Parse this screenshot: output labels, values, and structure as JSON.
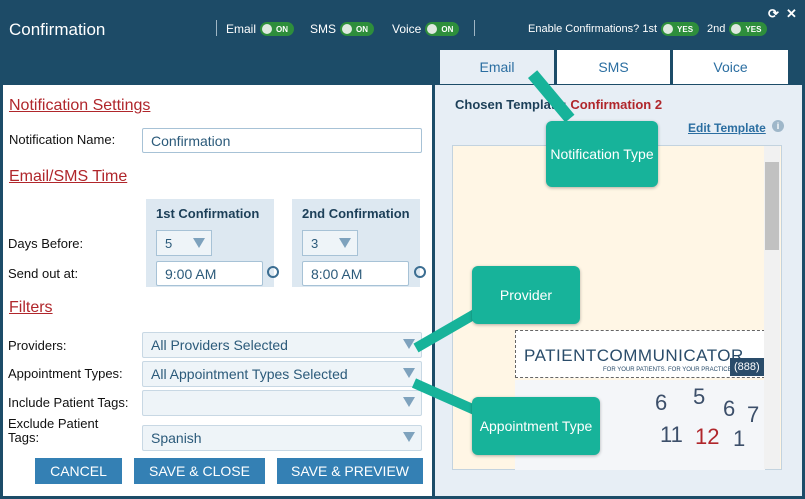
{
  "window": {
    "title": "Confirmation"
  },
  "header": {
    "email_label": "Email",
    "sms_label": "SMS",
    "voice_label": "Voice",
    "toggle_on": "ON",
    "enable_label": "Enable Confirmations? 1st",
    "second_label": "2nd",
    "toggle_yes": "YES"
  },
  "form": {
    "notification_settings": "Notification Settings",
    "notification_name_label": "Notification Name:",
    "notification_name_value": "Confirmation",
    "email_sms_time": "Email/SMS Time",
    "first_conf": "1st Confirmation",
    "second_conf": "2nd Confirmation",
    "days_before_label": "Days Before:",
    "send_out_label": "Send out at:",
    "first_days": "5",
    "second_days": "3",
    "first_time": "9:00 AM",
    "second_time": "8:00 AM",
    "filters": "Filters",
    "providers_label": "Providers:",
    "providers_value": "All Providers Selected",
    "appt_types_label": "Appointment Types:",
    "appt_types_value": "All Appointment Types Selected",
    "include_tags_label": "Include Patient Tags:",
    "include_tags_value": "",
    "exclude_tags_label_1": "Exclude Patient",
    "exclude_tags_label_2": "Tags:",
    "exclude_tags_value": "Spanish"
  },
  "buttons": {
    "cancel": "CANCEL",
    "save_close": "SAVE & CLOSE",
    "save_preview": "SAVE & PREVIEW"
  },
  "tabs": [
    {
      "label": "Email"
    },
    {
      "label": "SMS"
    },
    {
      "label": "Voice"
    }
  ],
  "template": {
    "chosen_label": "Chosen Template:",
    "chosen_value": "Confirmation 2",
    "edit_link": "Edit Template",
    "logo_text": "PATIENTCOMMUNICATOR",
    "logo_tagline": "FOR YOUR PATIENTS.  FOR YOUR PRACTICE.",
    "phone": "(888)"
  },
  "callouts": {
    "notification_type": "Notification Type",
    "provider": "Provider",
    "appointment_type": "Appointment Type"
  },
  "colors": {
    "header_bg": "#1d4b67",
    "accent_red": "#b0262b",
    "button_blue": "#3480b4",
    "callout": "#17b39a",
    "toggle_green": "#2e8e3c"
  }
}
